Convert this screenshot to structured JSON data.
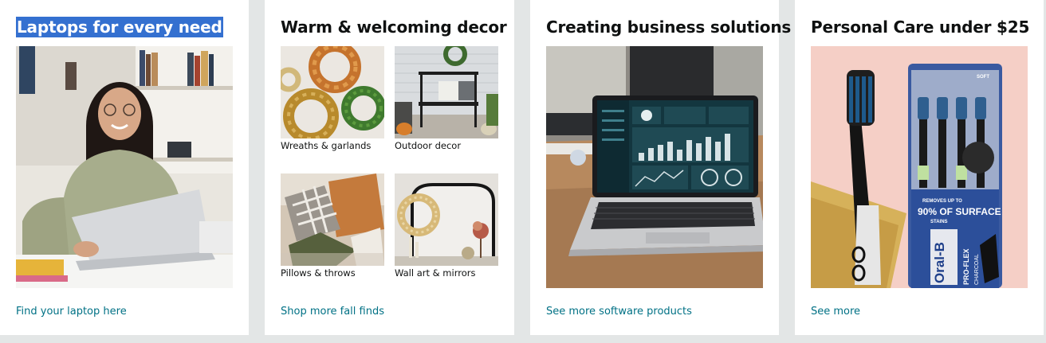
{
  "cards": [
    {
      "title": "Laptops for every need",
      "link": "Find your laptop here"
    },
    {
      "title": "Warm & welcoming decor",
      "items": [
        {
          "label": "Wreaths & garlands"
        },
        {
          "label": "Outdoor decor"
        },
        {
          "label": "Pillows & throws"
        },
        {
          "label": "Wall art & mirrors"
        }
      ],
      "link": "Shop more fall finds"
    },
    {
      "title": "Creating business solutions",
      "link": "See more software products"
    },
    {
      "title": "Personal Care under $25",
      "link": "See more",
      "product_text": {
        "brand": "Oral-B",
        "line": "PRO-FLEX",
        "variant": "CHARCOAL",
        "soft": "SOFT",
        "claim_1": "REMOVES UP TO",
        "claim_2": "90% OF SURFACE",
        "claim_3": "STAINS"
      }
    }
  ],
  "colors": {
    "page_bg": "#e3e6e6",
    "link": "#007185",
    "selection": "#3470d0",
    "title": "#0f1111"
  }
}
